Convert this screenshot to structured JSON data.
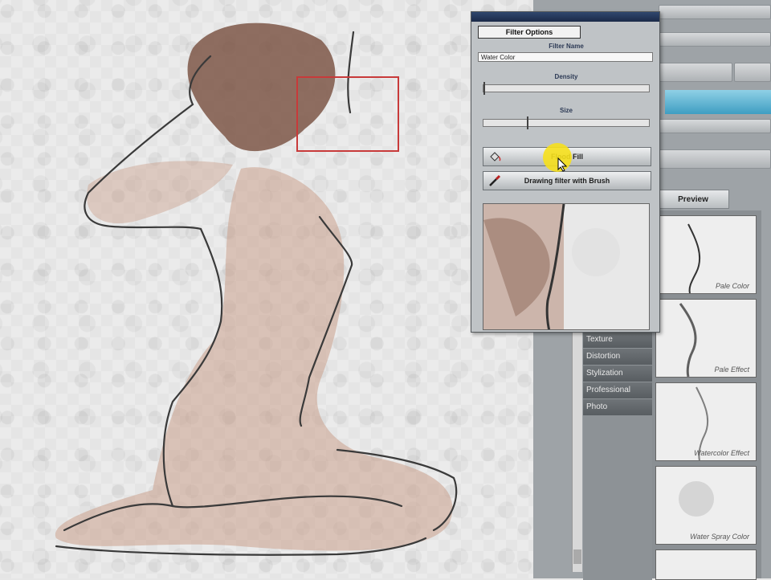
{
  "dialog": {
    "tab_label": "Filter Options",
    "filter_name_label": "Filter Name",
    "filter_name_value": "Water Color",
    "density_label": "Density",
    "size_label": "Size",
    "flood_fill_label": "Flood Fill",
    "drawing_label": "Drawing filter with Brush"
  },
  "toolbar": {
    "preview_label": "Preview"
  },
  "categories": [
    "Texture",
    "Distortion",
    "Stylization",
    "Professional",
    "Photo"
  ],
  "thumbnails": [
    {
      "label": "Pale Color"
    },
    {
      "label": "Pale Effect"
    },
    {
      "label": "Watercolor Effect"
    },
    {
      "label": "Water Spray Color"
    }
  ],
  "colors": {
    "selection": "#c83a3a",
    "highlight": "#f6e01c",
    "accent_blue": "#3f9ec2"
  },
  "sliders": {
    "density_fraction": 0.0,
    "size_fraction": 0.26
  }
}
